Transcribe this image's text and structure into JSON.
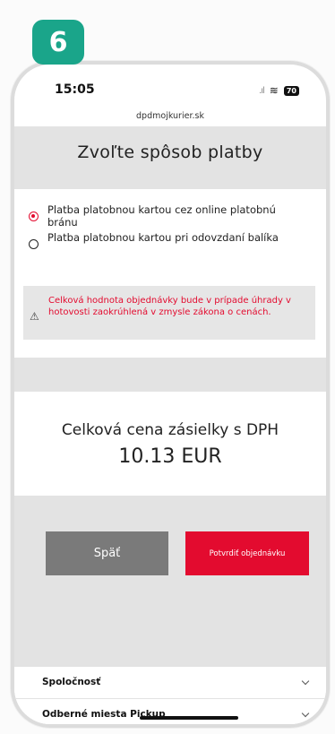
{
  "step_badge": "6",
  "status_bar": {
    "time": "15:05",
    "signal": ".ıl",
    "wifi": "≋",
    "battery": "70"
  },
  "browser": {
    "url": "dpdmojkurier.sk"
  },
  "page": {
    "title": "Zvoľte spôsob platby"
  },
  "payment_options": [
    {
      "label": "Platba platobnou kartou cez online platobnú bránu",
      "selected": true
    },
    {
      "label": "Platba platobnou kartou pri odovzdaní balíka",
      "selected": false
    }
  ],
  "notice": {
    "icon": "warning-icon",
    "text": "Celková hodnota objednávky bude v prípade úhrady v hotovosti zaokrúhlená v zmysle zákona o cenách."
  },
  "price": {
    "label": "Celková cena zásielky s DPH",
    "value": "10.13 EUR"
  },
  "buttons": {
    "back": "Späť",
    "confirm": "Potvrdiť objednávku"
  },
  "footer": [
    {
      "label": "Spoločnosť"
    },
    {
      "label": "Odberné miesta Pickup"
    }
  ],
  "colors": {
    "accent": "#e30b2f",
    "badge": "#1aa58a",
    "band": "#e3e3e3",
    "back_button": "#7a7a7a"
  }
}
